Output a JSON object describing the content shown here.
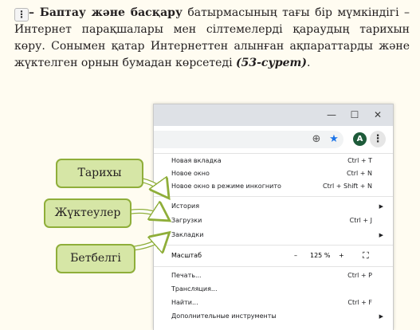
{
  "paragraph": {
    "icon": "kebab-menu-icon",
    "icon_glyph": "⋮",
    "dash_bold": "– Баптау және басқару",
    "body": " батырмасының тағы бір мүмкіндігі – Интернет парақшалары мен сілтемелерді қараудың тарихын көру. Сонымен қатар Интернеттен алынған ақпараттарды және жүктелген орнын бумадан көрсетеді ",
    "figure_ref": "(53-сурет)",
    "end": "."
  },
  "window": {
    "controls": {
      "minimize": "—",
      "maximize": "☐",
      "close": "✕"
    },
    "toolbar": {
      "zoom_icon": "zoom-icon",
      "zoom_glyph": "⊕",
      "star_icon": "bookmark-star-icon",
      "star_glyph": "★",
      "avatar_letter": "A",
      "menu_glyph": "⋮"
    },
    "menu": {
      "new_tab": {
        "label": "Новая вкладка",
        "shortcut": "Ctrl + T"
      },
      "new_window": {
        "label": "Новое окно",
        "shortcut": "Ctrl + N"
      },
      "incognito": {
        "label": "Новое окно в режиме инкогнито",
        "shortcut": "Ctrl + Shift + N"
      },
      "history": {
        "label": "История",
        "arrow": "▶"
      },
      "downloads": {
        "label": "Загрузки",
        "shortcut": "Ctrl + J"
      },
      "bookmarks": {
        "label": "Закладки",
        "arrow": "▶"
      },
      "zoom": {
        "label": "Масштаб",
        "minus": "–",
        "value": "125 %",
        "plus": "+",
        "fullscreen": "⛶"
      },
      "print": {
        "label": "Печать...",
        "shortcut": "Ctrl + P"
      },
      "cast": {
        "label": "Трансляция..."
      },
      "find": {
        "label": "Найти...",
        "shortcut": "Ctrl + F"
      },
      "more_tools": {
        "label": "Дополнительные инструменты",
        "arrow": "▶"
      }
    }
  },
  "callouts": {
    "history": "Тарихы",
    "downloads": "Жүктеулер",
    "bookmarks": "Бетбелгі"
  },
  "colors": {
    "callout_fill": "#d6e6a6",
    "callout_border": "#8fae3a",
    "page_bg": "#fffcf1",
    "titlebar": "#dee1e6",
    "avatar": "#1e5b3a"
  }
}
